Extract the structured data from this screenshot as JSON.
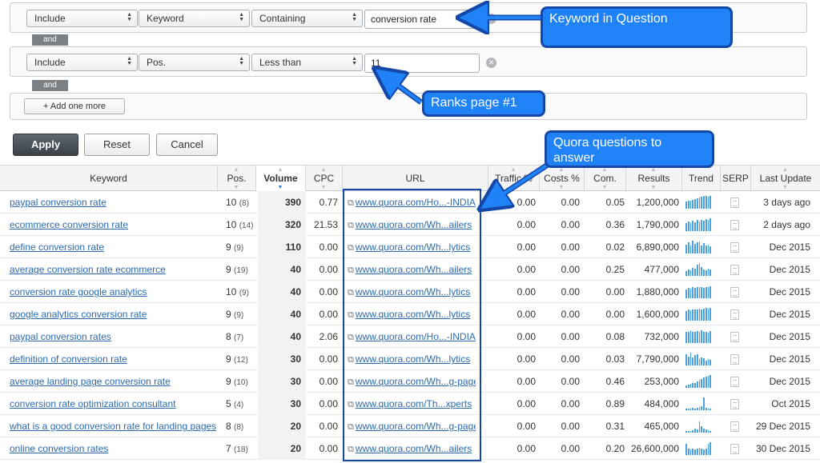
{
  "filters": [
    {
      "mode": "Include",
      "field": "Keyword",
      "operator": "Containing",
      "value": "conversion rate"
    },
    {
      "mode": "Include",
      "field": "Pos.",
      "operator": "Less than",
      "value": "11"
    }
  ],
  "and_label": "and",
  "add_more_label": "+ Add one more",
  "buttons": {
    "apply": "Apply",
    "reset": "Reset",
    "cancel": "Cancel"
  },
  "callouts": {
    "keyword": "Keyword in Question",
    "ranks": "Ranks page #1",
    "quora": "Quora questions to answer"
  },
  "columns": [
    "Keyword",
    "Pos.",
    "Volume",
    "CPC",
    "URL",
    "Traffic %",
    "Costs %",
    "Com.",
    "Results",
    "Trend",
    "SERP",
    "Last Update"
  ],
  "rows": [
    {
      "keyword": "paypal conversion rate",
      "pos": "10",
      "prev": "(8)",
      "volume": "390",
      "cpc": "0.77",
      "url": "www.quora.com/Ho...-INDIA",
      "traffic": "0.00",
      "costs": "0.00",
      "com": "0.05",
      "results": "1,200,000",
      "updated": "3 days ago",
      "trend": [
        0.55,
        0.6,
        0.65,
        0.7,
        0.75,
        0.8,
        0.85,
        0.95,
        1,
        1,
        0.95,
        1
      ]
    },
    {
      "keyword": "ecommerce conversion rate",
      "pos": "10",
      "prev": "(14)",
      "volume": "320",
      "cpc": "21.53",
      "url": "www.quora.com/Wh...ailers",
      "traffic": "0.00",
      "costs": "0.00",
      "com": "0.36",
      "results": "1,790,000",
      "updated": "2 days ago",
      "trend": [
        0.6,
        0.75,
        0.6,
        0.8,
        0.7,
        0.85,
        0.75,
        0.9,
        0.8,
        0.95,
        0.85,
        1
      ]
    },
    {
      "keyword": "define conversion rate",
      "pos": "9",
      "prev": "(9)",
      "volume": "110",
      "cpc": "0.00",
      "url": "www.quora.com/Wh...lytics",
      "traffic": "0.00",
      "costs": "0.00",
      "com": "0.02",
      "results": "6,890,000",
      "updated": "Dec 2015",
      "trend": [
        0.7,
        0.9,
        0.6,
        1,
        0.75,
        0.85,
        0.95,
        0.65,
        0.8,
        0.6,
        0.7,
        0.55
      ]
    },
    {
      "keyword": "average conversion rate ecommerce",
      "pos": "9",
      "prev": "(19)",
      "volume": "40",
      "cpc": "0.00",
      "url": "www.quora.com/Wh...ailers",
      "traffic": "0.00",
      "costs": "0.00",
      "com": "0.25",
      "results": "477,000",
      "updated": "Dec 2015",
      "trend": [
        0.4,
        0.5,
        0.45,
        0.6,
        0.55,
        0.9,
        1,
        0.7,
        0.5,
        0.45,
        0.55,
        0.5
      ]
    },
    {
      "keyword": "conversion rate google analytics",
      "pos": "10",
      "prev": "(9)",
      "volume": "40",
      "cpc": "0.00",
      "url": "www.quora.com/Wh...lytics",
      "traffic": "0.00",
      "costs": "0.00",
      "com": "0.00",
      "results": "1,880,000",
      "updated": "Dec 2015",
      "trend": [
        0.7,
        0.8,
        0.75,
        0.85,
        0.8,
        0.9,
        0.85,
        0.9,
        0.8,
        0.85,
        0.9,
        0.95
      ]
    },
    {
      "keyword": "google analytics conversion rate",
      "pos": "9",
      "prev": "(9)",
      "volume": "40",
      "cpc": "0.00",
      "url": "www.quora.com/Wh...lytics",
      "traffic": "0.00",
      "costs": "0.00",
      "com": "0.00",
      "results": "1,600,000",
      "updated": "Dec 2015",
      "trend": [
        0.75,
        0.85,
        0.8,
        0.9,
        0.85,
        0.9,
        0.95,
        0.9,
        0.95,
        1,
        0.95,
        1
      ]
    },
    {
      "keyword": "paypal conversion rates",
      "pos": "8",
      "prev": "(7)",
      "volume": "40",
      "cpc": "2.06",
      "url": "www.quora.com/Ho...-INDIA",
      "traffic": "0.00",
      "costs": "0.00",
      "com": "0.08",
      "results": "732,000",
      "updated": "Dec 2015",
      "trend": [
        0.85,
        0.9,
        1,
        0.9,
        0.85,
        0.95,
        0.9,
        1,
        0.85,
        0.9,
        0.8,
        0.95
      ]
    },
    {
      "keyword": "definition of conversion rate",
      "pos": "9",
      "prev": "(12)",
      "volume": "30",
      "cpc": "0.00",
      "url": "www.quora.com/Wh...lytics",
      "traffic": "0.00",
      "costs": "0.00",
      "com": "0.03",
      "results": "7,790,000",
      "updated": "Dec 2015",
      "trend": [
        0.9,
        0.7,
        1,
        0.6,
        0.8,
        0.9,
        0.5,
        0.6,
        0.55,
        0.4,
        0.5,
        0.45
      ]
    },
    {
      "keyword": "average landing page conversion rate",
      "pos": "9",
      "prev": "(10)",
      "volume": "30",
      "cpc": "0.00",
      "url": "www.quora.com/Wh...g-page",
      "traffic": "0.00",
      "costs": "0.00",
      "com": "0.46",
      "results": "253,000",
      "updated": "Dec 2015",
      "trend": [
        0.2,
        0.25,
        0.3,
        0.35,
        0.4,
        0.5,
        0.6,
        0.7,
        0.8,
        0.85,
        0.95,
        1
      ]
    },
    {
      "keyword": "conversion rate optimization consultant",
      "pos": "5",
      "prev": "(4)",
      "volume": "30",
      "cpc": "0.00",
      "url": "www.quora.com/Th...xperts",
      "traffic": "0.00",
      "costs": "0.00",
      "com": "0.89",
      "results": "484,000",
      "updated": "Oct 2015",
      "trend": [
        0.1,
        0.15,
        0.1,
        0.2,
        0.15,
        0.2,
        0.25,
        0.3,
        1,
        0.2,
        0.15,
        0.1
      ]
    },
    {
      "keyword": "what is a good conversion rate for landing pages",
      "pos": "8",
      "prev": "(8)",
      "volume": "20",
      "cpc": "0.00",
      "url": "www.quora.com/Wh...g-page",
      "traffic": "0.00",
      "costs": "0.00",
      "com": "0.31",
      "results": "465,000",
      "updated": "29 Dec 2015",
      "trend": [
        0.1,
        0.15,
        0.1,
        0.2,
        0.3,
        0.25,
        0.9,
        0.5,
        0.3,
        0.25,
        0.2,
        0.15
      ]
    },
    {
      "keyword": "online conversion rates",
      "pos": "7",
      "prev": "(18)",
      "volume": "20",
      "cpc": "0.00",
      "url": "www.quora.com/Wh...ailers",
      "traffic": "0.00",
      "costs": "0.00",
      "com": "0.20",
      "results": "26,600,000",
      "updated": "30 Dec 2015",
      "trend": [
        0.9,
        0.5,
        0.45,
        0.5,
        0.45,
        0.5,
        0.55,
        0.5,
        0.45,
        0.5,
        0.9,
        1
      ]
    }
  ],
  "colors": {
    "callout_fill": "#1f82f6",
    "callout_border": "#1447a8",
    "link": "#2b6ab0",
    "spark": "#4aa3df"
  },
  "icons": {
    "external": "external-link-icon",
    "serp": "document-icon",
    "clear": "close-icon"
  }
}
